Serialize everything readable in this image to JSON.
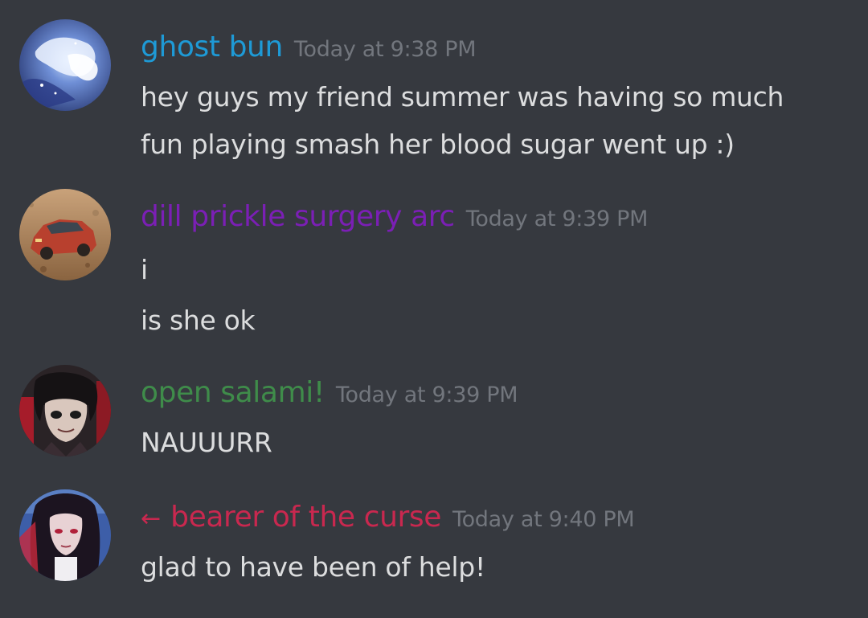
{
  "messages": [
    {
      "author": "ghost bun",
      "author_color": "#1e9ad6",
      "timestamp": "Today at 9:38 PM",
      "avatar_icon": "ghost-hand-avatar",
      "lines": [
        "hey guys my friend summer was having so much",
        "fun playing smash her blood sugar went up :)"
      ]
    },
    {
      "author": "dill prickle surgery arc",
      "author_color": "#7b1fb5",
      "timestamp": "Today at 9:39 PM",
      "avatar_icon": "red-car-avatar",
      "lines": [
        "i",
        "is she ok"
      ]
    },
    {
      "author": "open salami!",
      "author_color": "#3f8c4a",
      "timestamp": "Today at 9:39 PM",
      "avatar_icon": "dark-haired-character-avatar",
      "lines": [
        "NAUUURR"
      ]
    },
    {
      "author": "bearer of the curse",
      "author_color": "#c9284f",
      "reply_arrow": "←",
      "timestamp": "Today at 9:40 PM",
      "avatar_icon": "long-haired-character-avatar",
      "lines": [
        "glad to have been of help!"
      ]
    }
  ]
}
